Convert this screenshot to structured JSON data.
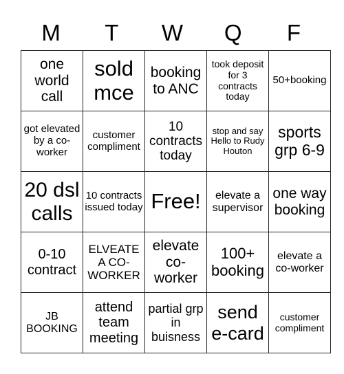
{
  "header": [
    "M",
    "T",
    "W",
    "Q",
    "F"
  ],
  "cells": [
    [
      {
        "text": "one world call",
        "size": 21
      },
      {
        "text": "sold mce",
        "size": 31
      },
      {
        "text": "booking to ANC",
        "size": 21
      },
      {
        "text": "took deposit for 3 contracts today",
        "size": 14
      },
      {
        "text": "50+booking",
        "size": 15
      }
    ],
    [
      {
        "text": "got elevated by a co-worker",
        "size": 15
      },
      {
        "text": "customer compliment",
        "size": 15
      },
      {
        "text": "10 contracts today",
        "size": 19
      },
      {
        "text": "stop and say Hello to Rudy Houton",
        "size": 13
      },
      {
        "text": "sports grp 6-9",
        "size": 23
      }
    ],
    [
      {
        "text": "20 dsl calls",
        "size": 30
      },
      {
        "text": "10 contracts issued today",
        "size": 15
      },
      {
        "text": "Free!",
        "size": 31
      },
      {
        "text": "elevate a supervisor",
        "size": 16
      },
      {
        "text": "one way booking",
        "size": 21
      }
    ],
    [
      {
        "text": "0-10 contract",
        "size": 20
      },
      {
        "text": "ELVEATE A CO-WORKER",
        "size": 17
      },
      {
        "text": "elevate co-worker",
        "size": 21
      },
      {
        "text": "100+ booking",
        "size": 22
      },
      {
        "text": "elevate a co-worker",
        "size": 16
      }
    ],
    [
      {
        "text": "JB BOOKING",
        "size": 16
      },
      {
        "text": "attend team meeting",
        "size": 20
      },
      {
        "text": "partial grp in buisness",
        "size": 18
      },
      {
        "text": "send e-card",
        "size": 27
      },
      {
        "text": "customer compliment",
        "size": 14
      }
    ]
  ]
}
